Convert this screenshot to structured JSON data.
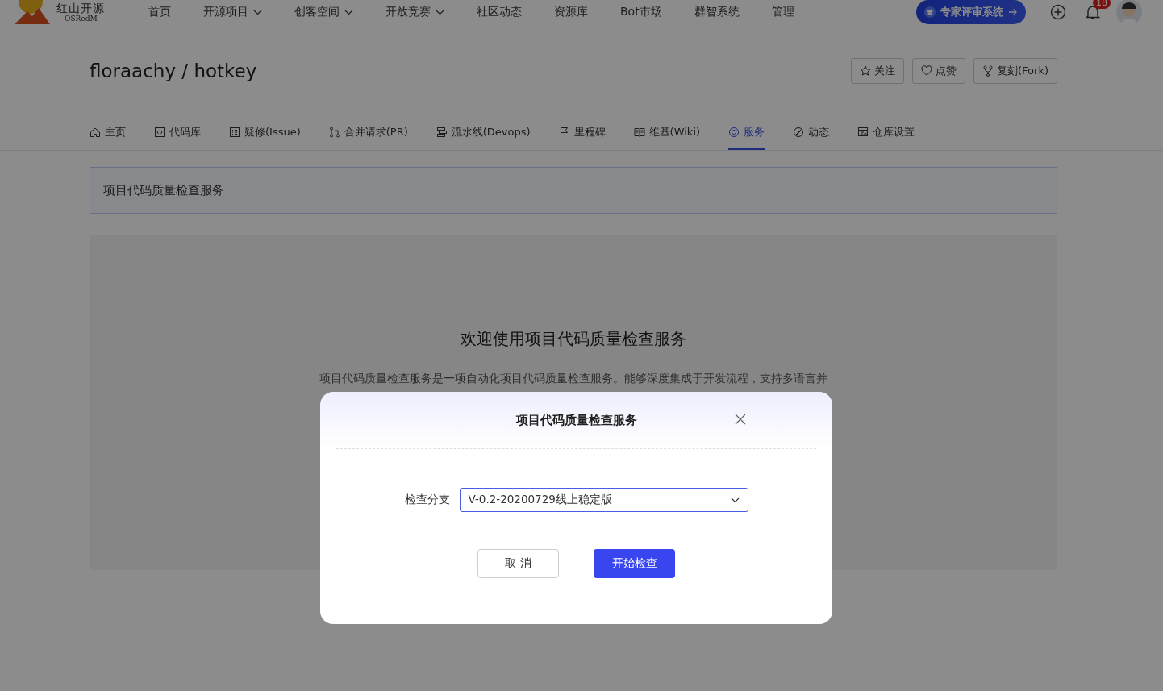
{
  "header": {
    "logo": {
      "name": "红山开源",
      "sub": "OSRedM"
    },
    "nav": [
      {
        "label": "首页",
        "dropdown": false
      },
      {
        "label": "开源项目",
        "dropdown": true
      },
      {
        "label": "创客空间",
        "dropdown": true
      },
      {
        "label": "开放竞赛",
        "dropdown": true
      },
      {
        "label": "社区动态",
        "dropdown": false
      },
      {
        "label": "资源库",
        "dropdown": false
      },
      {
        "label": "Bot市场",
        "dropdown": false
      },
      {
        "label": "群智系统",
        "dropdown": false
      },
      {
        "label": "管理",
        "dropdown": false
      }
    ],
    "expert_button": "专家评审系统",
    "notification_count": "18"
  },
  "repo": {
    "title": "floraachy / hotkey",
    "actions": [
      {
        "label": "关注"
      },
      {
        "label": "点赞"
      },
      {
        "label": "复刻(Fork)"
      }
    ]
  },
  "tabs": [
    {
      "label": "主页",
      "selected": false
    },
    {
      "label": "代码库",
      "selected": false
    },
    {
      "label": "疑修(Issue)",
      "selected": false
    },
    {
      "label": "合并请求(PR)",
      "selected": false
    },
    {
      "label": "流水线(Devops)",
      "selected": false
    },
    {
      "label": "里程碑",
      "selected": false
    },
    {
      "label": "维基(Wiki)",
      "selected": false
    },
    {
      "label": "服务",
      "selected": true
    },
    {
      "label": "动态",
      "selected": false
    },
    {
      "label": "仓库设置",
      "selected": false
    }
  ],
  "service_title": "项目代码质量检查服务",
  "welcome": {
    "heading": "欢迎使用项目代码质量检查服务",
    "description": "项目代码质量检查服务是一项自动化项目代码质量检查服务。能够深度集成于开发流程，支持多语言并"
  },
  "dialog": {
    "title": "项目代码质量检查服务",
    "field_label": "检查分支",
    "branch": "V-0.2-20200729线上稳定版",
    "buttons": [
      {
        "label": "取 消",
        "kind": "secondary"
      },
      {
        "label": "开始检查",
        "kind": "primary"
      }
    ]
  }
}
